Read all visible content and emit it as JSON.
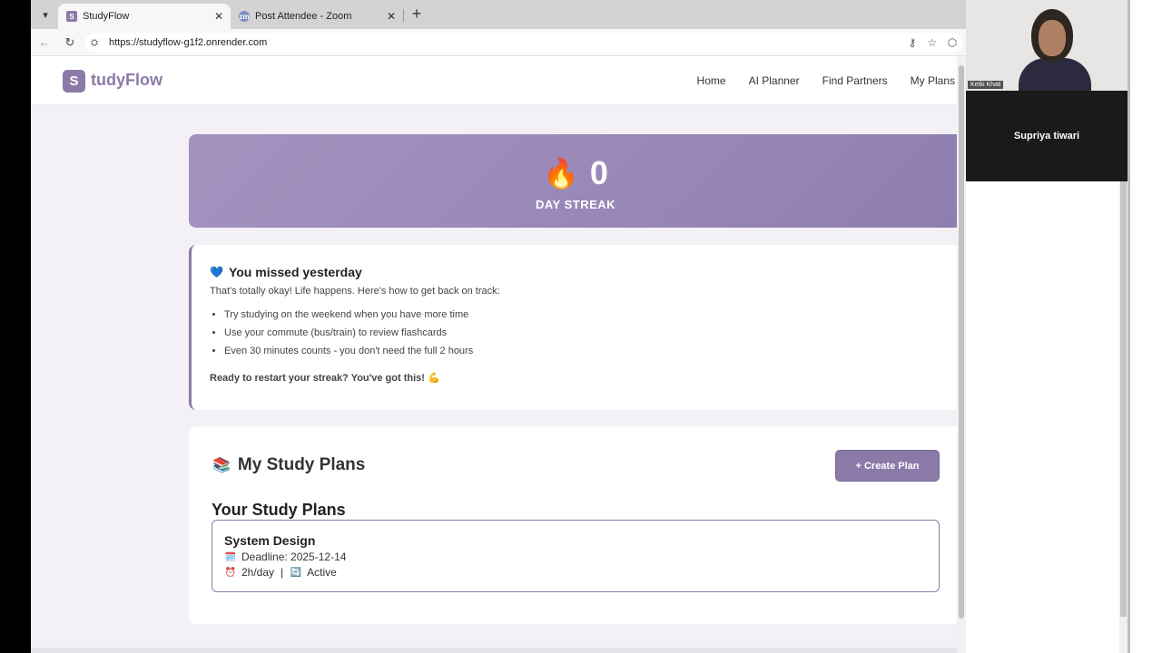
{
  "browser": {
    "tabs": [
      {
        "title": "StudyFlow",
        "favicon": "S",
        "active": true
      },
      {
        "title": "Post Attendee - Zoom",
        "favicon": "zm",
        "active": false
      }
    ],
    "url": "https://studyflow-g1f2.onrender.com"
  },
  "site": {
    "logo_letter": "S",
    "logo_text": "tudyFlow",
    "nav": [
      "Home",
      "AI Planner",
      "Find Partners",
      "My Plans"
    ]
  },
  "streak": {
    "icon": "🔥",
    "count": "0",
    "label": "DAY STREAK"
  },
  "missed": {
    "icon": "💙",
    "title": "You missed yesterday",
    "subtitle": "That's totally okay! Life happens. Here's how to get back on track:",
    "tips": [
      "Try studying on the weekend when you have more time",
      "Use your commute (bus/train) to review flashcards",
      "Even 30 minutes counts - you don't need the full 2 hours"
    ],
    "cta": "Ready to restart your streak? You've got this! 💪"
  },
  "plans": {
    "icon": "📚",
    "title": "My Study Plans",
    "create_label": "+ Create Plan",
    "subheading": "Your Study Plans",
    "items": [
      {
        "name": "System Design",
        "deadline_icon": "🗓️",
        "deadline": "Deadline: 2025-12-14",
        "hours_icon": "⏰",
        "hours": "2h/day",
        "status_icon": "🔄",
        "status": "Active"
      }
    ]
  },
  "zoom": {
    "participant1": "Ketki Khati",
    "participant2": "Supriya tiwari"
  },
  "colors": {
    "accent": "#8b7aa8",
    "streak_gradient": [
      "#a393bf",
      "#8e7eb0"
    ]
  }
}
